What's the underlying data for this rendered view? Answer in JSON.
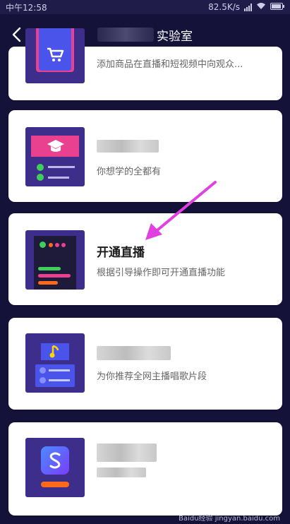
{
  "status_bar": {
    "carrier": "中午12:58",
    "network_speed": "82.5K/s",
    "signal_icon": "signal-icon",
    "wifi_icon": "wifi-icon",
    "battery_icon": "battery-icon"
  },
  "nav": {
    "title": "实验室",
    "back_icon": "back-icon"
  },
  "cards": [
    {
      "icon": "cart-icon",
      "title": "",
      "desc": "添加商品在直播和短视频中向观众..."
    },
    {
      "icon": "graduation-cap-icon",
      "title": "",
      "desc": "你想学的全都有"
    },
    {
      "icon": "live-icon",
      "title": "开通直播",
      "desc": "根据引导操作即可开通直播功能"
    },
    {
      "icon": "music-note-icon",
      "title": "",
      "desc": "为你推荐全网主播唱歌片段"
    },
    {
      "icon": "s-logo-icon",
      "title": "",
      "desc": ""
    }
  ],
  "annotation": {
    "arrow_color": "#e040e0"
  },
  "watermark": "Baidu经验 jingyan.baidu.com",
  "colors": {
    "background": "#15123a",
    "card": "#ffffff",
    "thumb": "#3c2e8a",
    "accent_pink": "#e9418f",
    "accent_green": "#3ecf5a",
    "accent_orange": "#ff6a1a"
  }
}
